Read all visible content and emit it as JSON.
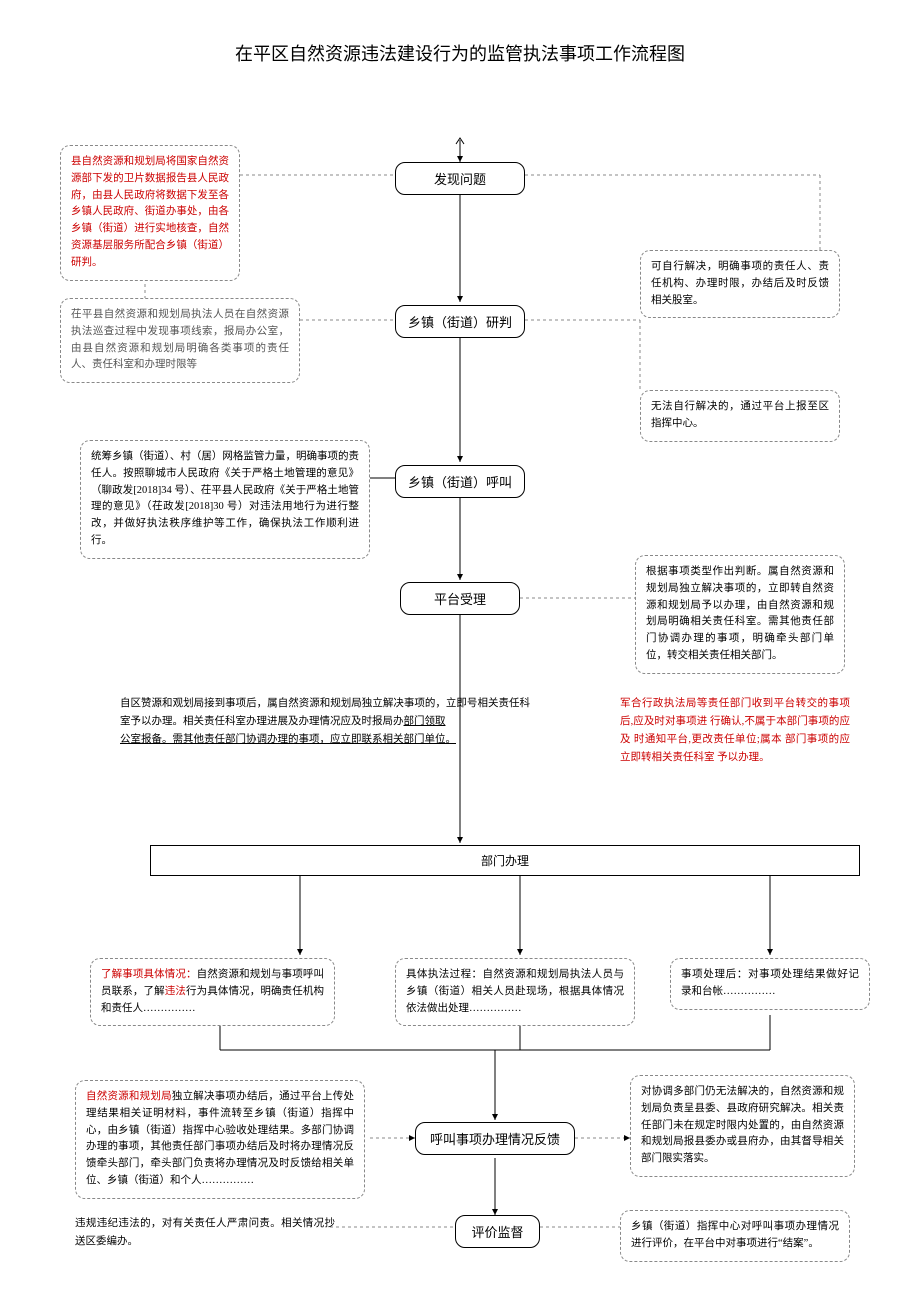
{
  "title": "在平区自然资源违法建设行为的监管执法事项工作流程图",
  "nodes": {
    "discover": "发现问题",
    "judge": "乡镇（街道）研判",
    "call": "乡镇（街道）呼叫",
    "accept": "平台受理",
    "dept_handle": "部门办理",
    "feedback": "呼叫事项办理情况反馈",
    "supervise": "评价监督"
  },
  "notes": {
    "top_left_red": "县自然资源和规划局将国家自然资源部下发的卫片数据报告县人民政府，由县人民政府将数据下发至各乡镇人民政府、街道办事处，由各乡镇（街道）进行实地核查，自然资源基层服务所配合乡镇（街道）研判。",
    "mid_left_gray": "茌平县自然资源和规划局执法人员在自然资源执法巡查过程中发现事项线索，报局办公室，由县自然资源和规划局明确各类事项的责任人、责任科室和办理时限等",
    "judge_right1": "可自行解决，明确事项的责任人、责任机构、办理时限，办结后及时反馈相关股室。",
    "judge_right2": "无法自行解决的，通过平台上报至区指挥中心。",
    "call_left": "统筹乡镇（街道）、村（居）网格监管力量，明确事项的责任人。按照聊城市人民政府《关于严格土地管理的意见》（聊政发[2018]34 号）、茌平县人民政府《关于严格土地管理的意见》（茌政发[2018]30 号）对违法用地行为进行整改，并做好执法秩序维护等工作，确保执法工作顺利进行。",
    "accept_right": "根据事项类型作出判断。属自然资源和规划局独立解决事项的，立即转自然资源和规划局予以办理，由自然资源和规划局明确相关责任科室。需其他责任部门协调办理的事项，明确牵头部门单位，转交相关责任相关部门。",
    "dept_left_plain": "自区赞源和观划局接到事项后，属自然资源和规划局独立解决事项的，立即号相关责任科室予以办理。相关责任科室办理进展及办理情况应及时报局办",
    "dept_left_uline1": "部门领取",
    "dept_left_plain2": "公室报备。需其他责任部门协调办理的事项，应立即联系相关部门单位。",
    "dept_right_red": "军合行政执法局等责任部门收到平台转交的事项后,应及时对事项进 行确认,不属于本部门事项的应及 时通知平台,更改责任单位;属本 部门事项的应立即转相关责任科室 予以办理。",
    "detail_left_red_title": "了解事项具体情况：",
    "detail_left_red_body1": "自然资源和规划与事项呼叫员联系，了解",
    "detail_left_red_body2": "违法",
    "detail_left_red_body3": "行为具体情况，明确责任机构和责任人……………",
    "detail_mid": "具体执法过程：自然资源和规划局执法人员与乡镇（街道）相关人员赴现场，根据具体情况依法做出处理……………",
    "detail_right": "事项处理后：对事项处理结果做好记录和台帐……………",
    "feedback_left_red_title": "自然资源和规划局",
    "feedback_left_body": "独立解决事项办结后，通过平台上传处理结果相关证明材料，事件流转至乡镇（街道）指挥中心，由乡镇（街道）指挥中心验收处理结果。多部门协调办理的事项，其他责任部门事项办结后及时将办理情况反馈牵头部门，牵头部门负责将办理情况及时反馈给相关单位、乡镇（街道）和个人……………",
    "feedback_right": "对协调多部门仍无法解决的，自然资源和规划局负责呈县委、县政府研究解决。相关责任部门未在规定时限内处置的，由自然资源和规划局报县委办或县府办，由其督导相关部门限实落实。",
    "supervise_left": "违规违纪违法的，对有关责任人严肃问责。相关情况抄送区委编办。",
    "supervise_right": "乡镇（街道）指挥中心对呼叫事项办理情况进行评价，在平台中对事项进行“结案”。"
  }
}
